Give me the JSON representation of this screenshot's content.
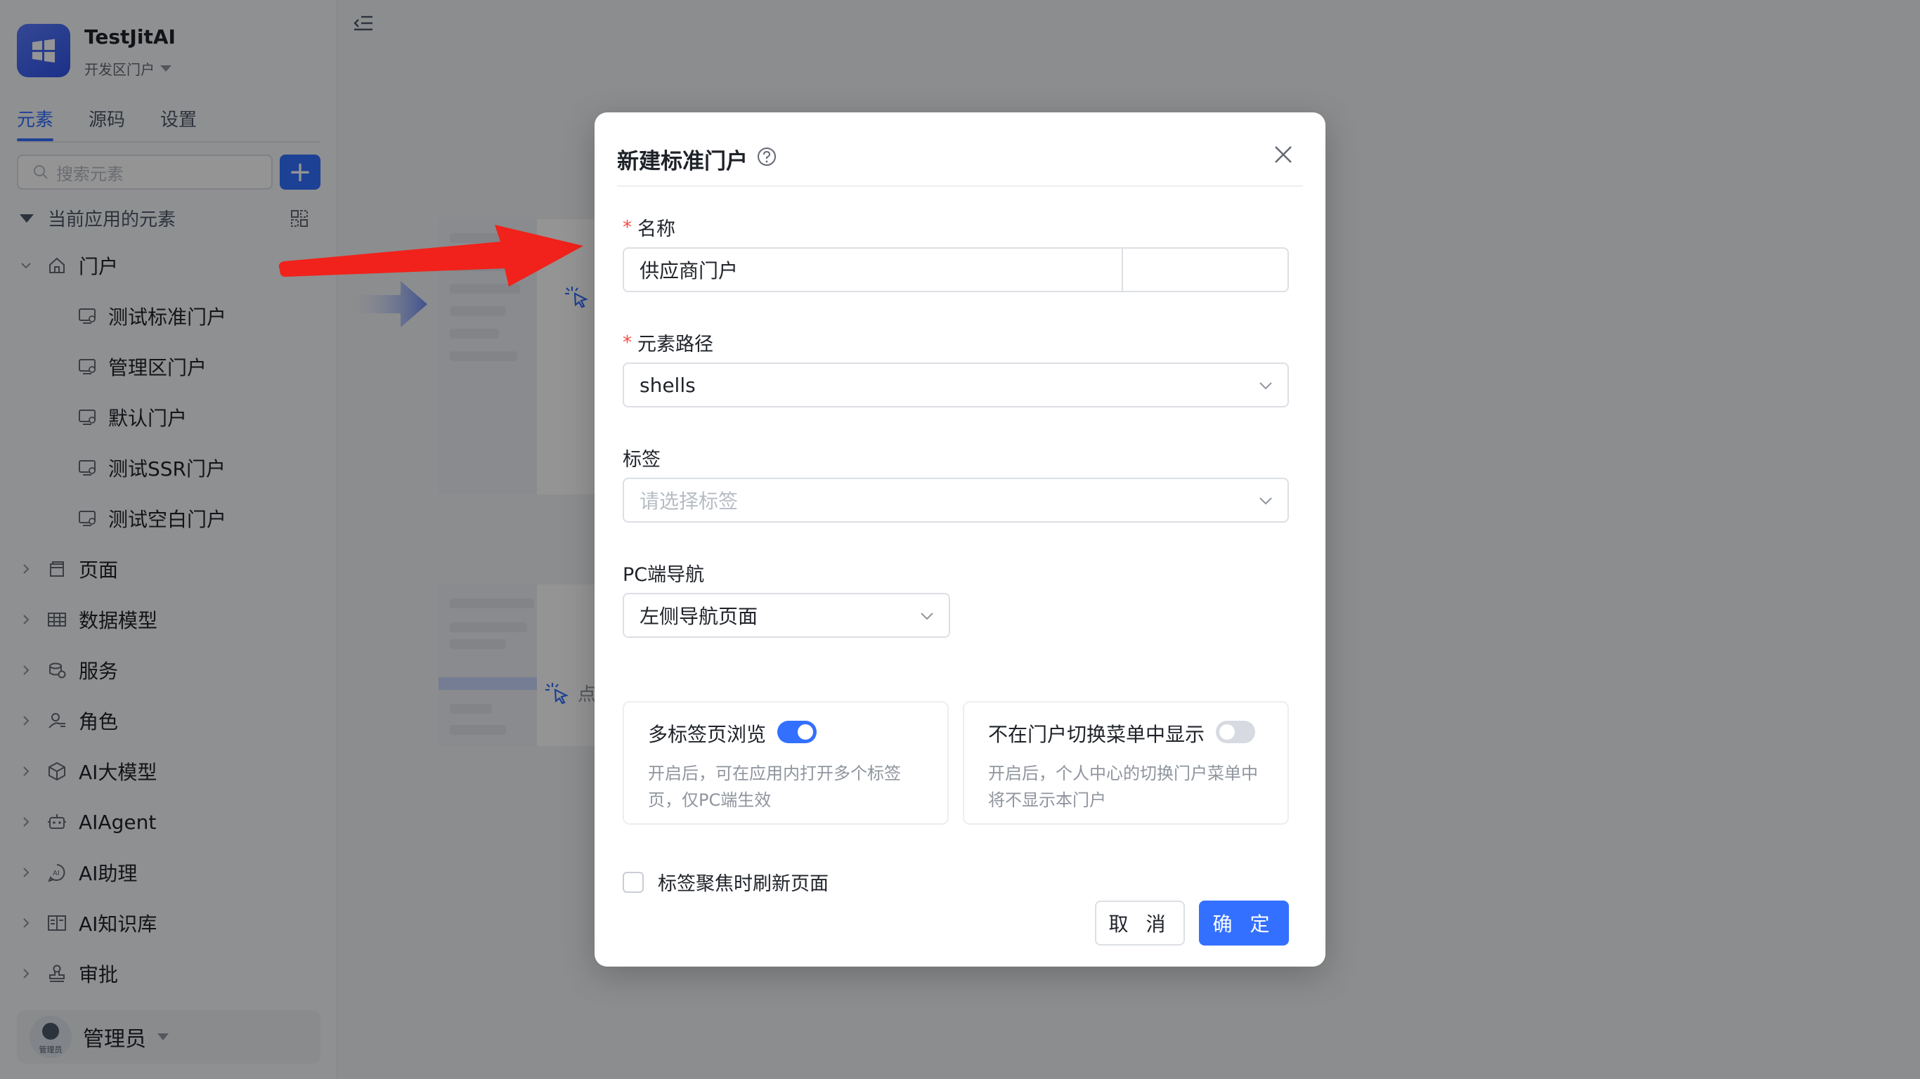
{
  "app": {
    "name": "TestJitAI",
    "environment": "开发区门户"
  },
  "sidebar": {
    "tabs": [
      {
        "label": "元素"
      },
      {
        "label": "源码"
      },
      {
        "label": "设置"
      }
    ],
    "search_placeholder": "搜索元素",
    "add_label": "+",
    "section_title": "当前应用的元素",
    "tree": [
      {
        "label": "门户",
        "icon": "home-icon",
        "expanded": true
      },
      {
        "label": "测试标准门户",
        "icon": "portal-icon"
      },
      {
        "label": "管理区门户",
        "icon": "portal-icon"
      },
      {
        "label": "默认门户",
        "icon": "portal-icon"
      },
      {
        "label": "测试SSR门户",
        "icon": "portal-icon"
      },
      {
        "label": "测试空白门户",
        "icon": "portal-icon"
      },
      {
        "label": "页面",
        "icon": "page-icon"
      },
      {
        "label": "数据模型",
        "icon": "table-icon"
      },
      {
        "label": "服务",
        "icon": "service-icon"
      },
      {
        "label": "角色",
        "icon": "role-icon"
      },
      {
        "label": "AI大模型",
        "icon": "model-icon"
      },
      {
        "label": "AIAgent",
        "icon": "robot-icon"
      },
      {
        "label": "AI助理",
        "icon": "ai-assistant-icon"
      },
      {
        "label": "AI知识库",
        "icon": "book-icon"
      },
      {
        "label": "审批",
        "icon": "approval-icon"
      }
    ],
    "user": {
      "avatar_caption": "管理员",
      "name": "管理员"
    }
  },
  "main": {
    "hint_text": "点"
  },
  "modal": {
    "title": "新建标准门户",
    "name_label": "名称",
    "name_value": "供应商门户",
    "path_label": "元素路径",
    "path_value": "shells",
    "tags_label": "标签",
    "tags_placeholder": "请选择标签",
    "pc_nav_label": "PC端导航",
    "pc_nav_value": "左侧导航页面",
    "multi_tab": {
      "title": "多标签页浏览",
      "desc": "开启后，可在应用内打开多个标签页，仅PC端生效",
      "on": true
    },
    "hide_switch": {
      "title": "不在门户切换菜单中显示",
      "desc": "开启后，个人中心的切换门户菜单中将不显示本门户",
      "on": false
    },
    "refresh_label": "标签聚焦时刷新页面",
    "cancel_label": "取 消",
    "ok_label": "确 定"
  },
  "colors": {
    "primary": "#3370ff",
    "required": "#f54a45",
    "annotation_arrow": "#f0221b"
  }
}
